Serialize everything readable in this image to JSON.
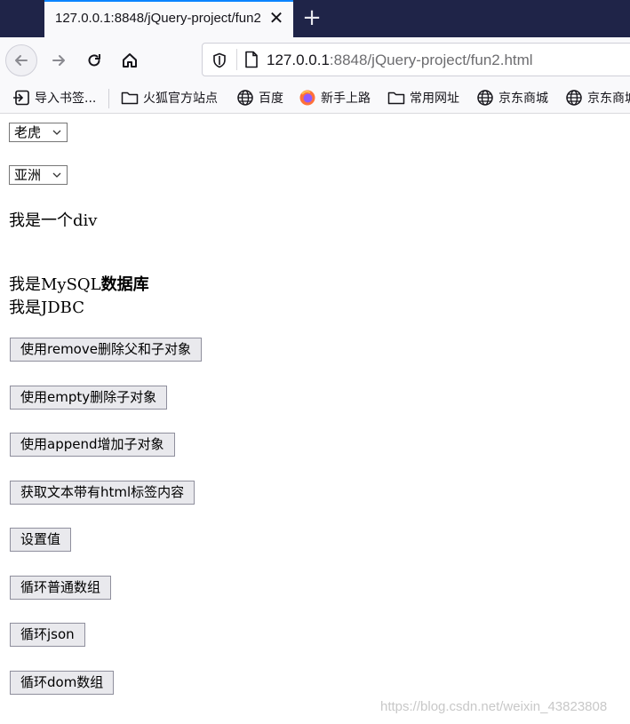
{
  "browser": {
    "tab_title": "127.0.0.1:8848/jQuery-project/fun2.html",
    "url_host": "127.0.0.1",
    "url_rest": ":8848/jQuery-project/fun2.html",
    "bookmarks": [
      {
        "label": "导入书签...",
        "icon": "import-icon"
      },
      {
        "label": "火狐官方站点",
        "icon": "folder-icon"
      },
      {
        "label": "百度",
        "icon": "globe-icon"
      },
      {
        "label": "新手上路",
        "icon": "firefox-icon"
      },
      {
        "label": "常用网址",
        "icon": "folder-icon"
      },
      {
        "label": "京东商城",
        "icon": "globe-icon"
      },
      {
        "label": "京东商城",
        "icon": "globe-icon"
      }
    ]
  },
  "page": {
    "select_animal": "老虎",
    "select_region": "亚洲",
    "div_text": "我是一个div",
    "mysql_prefix": "我是MySQL",
    "mysql_bold": "数据库",
    "jdbc_text": "我是JDBC",
    "buttons": [
      "使用remove删除父和子对象",
      "使用empty删除子对象",
      "使用append增加子对象",
      "获取文本带有html标签内容",
      "设置值",
      "循环普通数组",
      "循环json",
      "循环dom数组"
    ],
    "watermark": "https://blog.csdn.net/weixin_43823808"
  }
}
